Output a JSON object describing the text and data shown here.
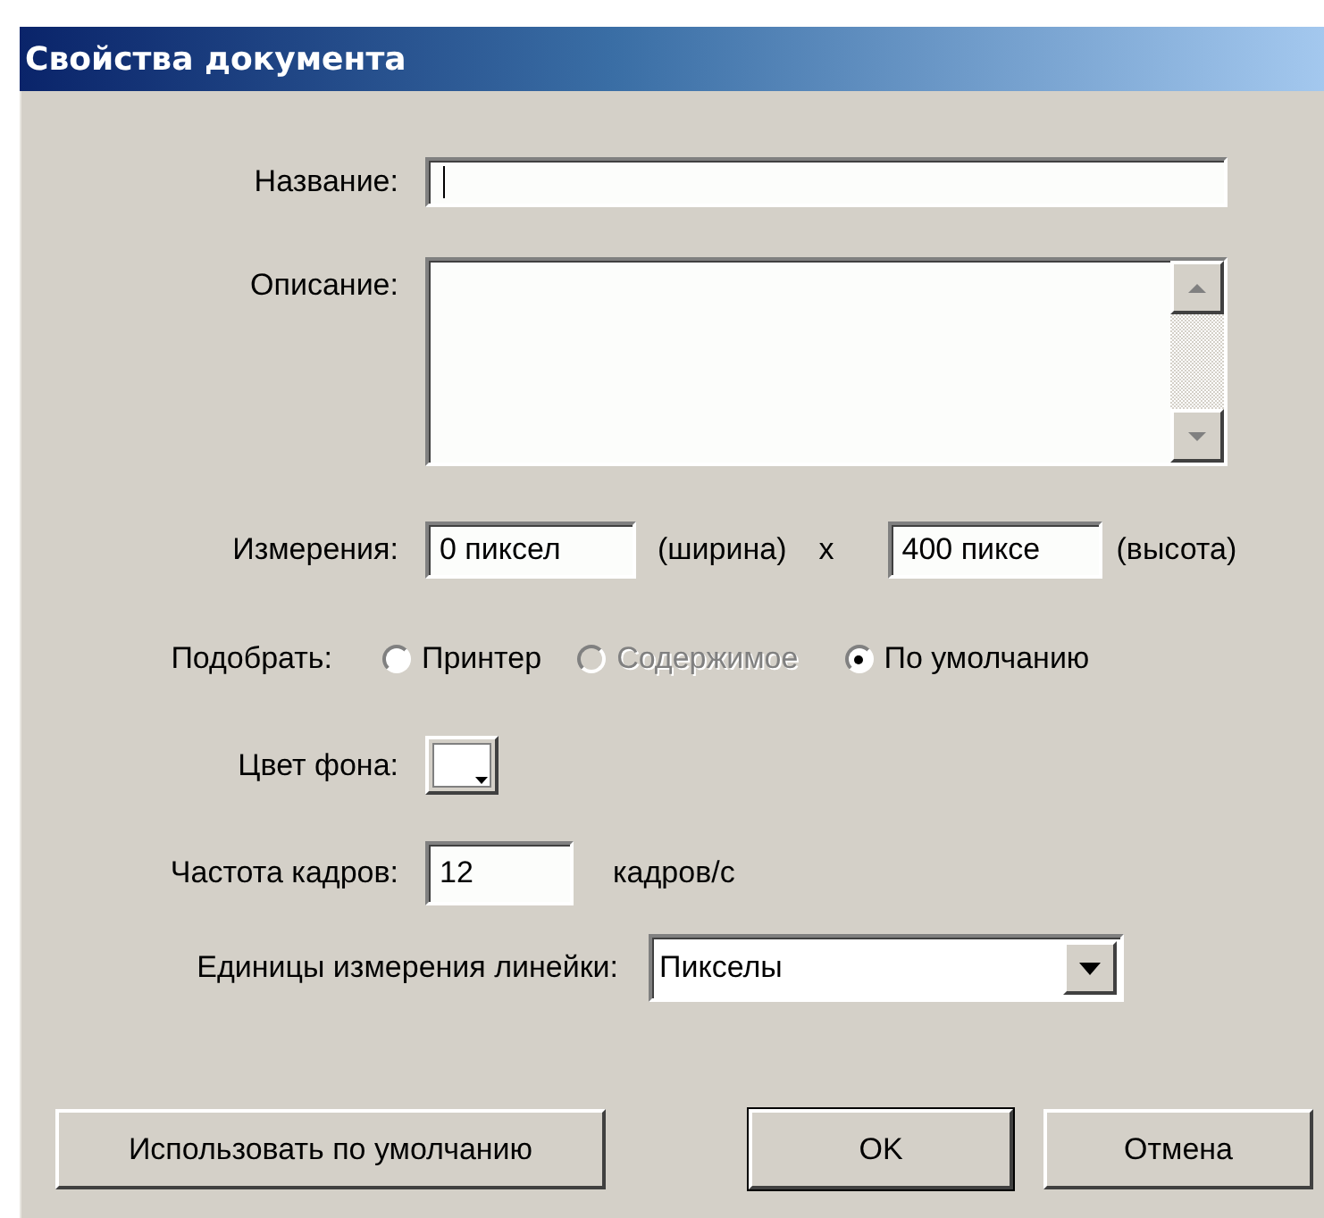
{
  "window": {
    "title": "Свойства документа"
  },
  "title_field": {
    "label": "Название:",
    "focused": true
  },
  "description": {
    "label": "Описание:"
  },
  "dimensions": {
    "label": "Измерения:",
    "width_value": "0 пиксел",
    "width_caption": "(ширина)",
    "separator": "x",
    "height_value": "400 пиксе",
    "height_caption": "(высота)"
  },
  "match": {
    "label": "Подобрать:",
    "options": [
      {
        "label": "Принтер",
        "selected": false,
        "disabled": false
      },
      {
        "label": "Содержимое",
        "selected": false,
        "disabled": true
      },
      {
        "label": "По умолчанию",
        "selected": true,
        "disabled": false
      }
    ]
  },
  "background_color": {
    "label": "Цвет фона:"
  },
  "frame_rate": {
    "label": "Частота кадров:",
    "value": "12",
    "unit": "кадров/с"
  },
  "ruler_units": {
    "label": "Единицы измерения линейки:",
    "value": "Пикселы"
  },
  "buttons": [
    {
      "label": "Использовать по умолчанию",
      "default": false
    },
    {
      "label": "OK",
      "default": true
    },
    {
      "label": "Отмена",
      "default": false
    }
  ]
}
